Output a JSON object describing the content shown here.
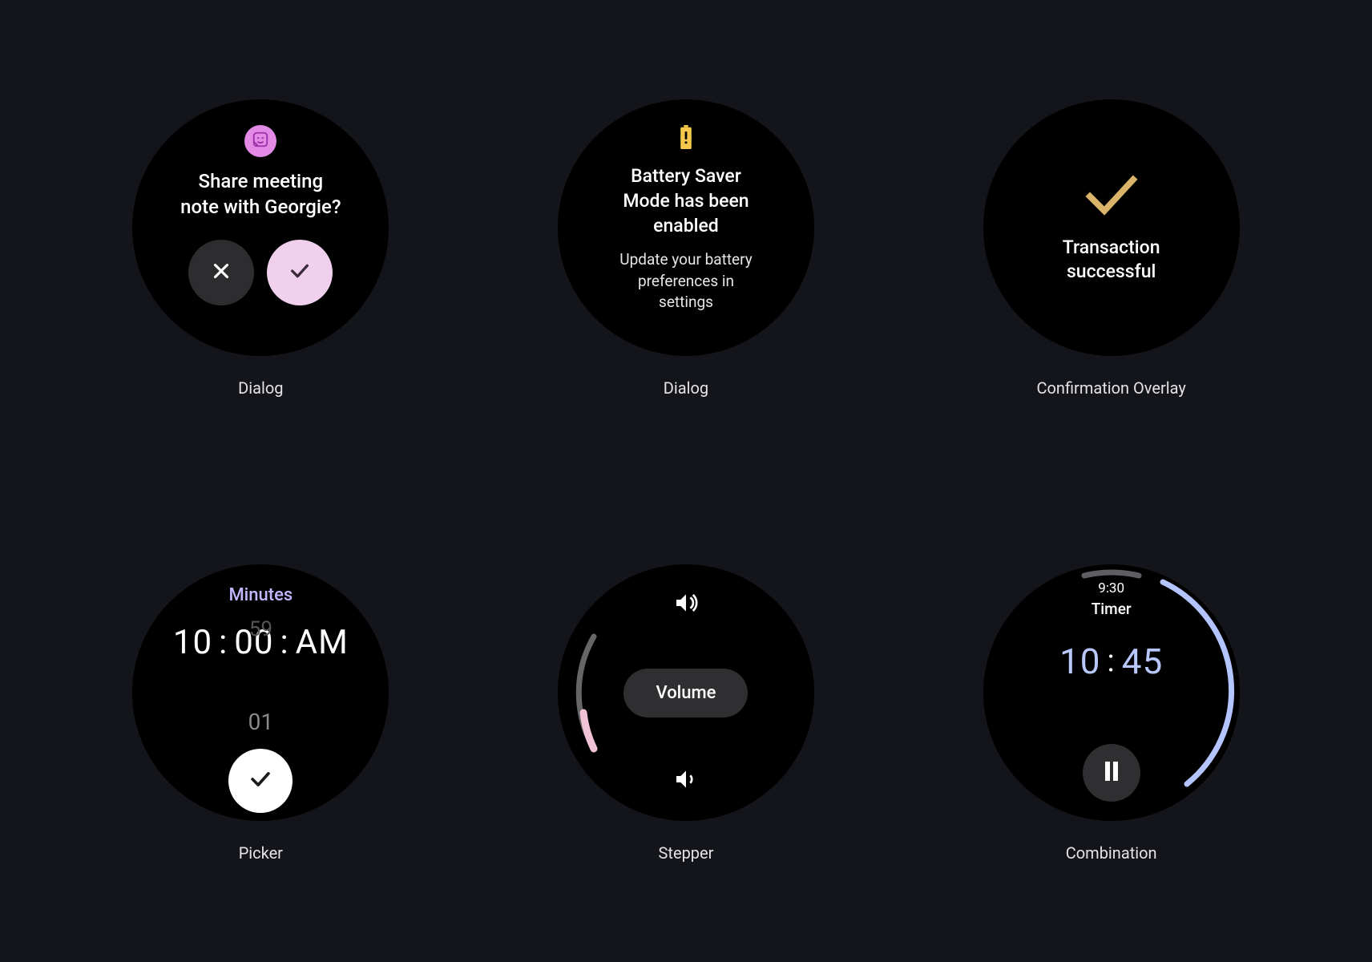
{
  "watches": [
    {
      "caption": "Dialog",
      "title": "Share meeting\nnote with Georgie?",
      "icon": "sticker-icon",
      "colors": {
        "accent": "#e28ae6",
        "confirm_bg": "#f1d0ed"
      }
    },
    {
      "caption": "Dialog",
      "title": "Battery Saver\nMode has been\nenabled",
      "subtitle": "Update your battery\npreferences in\nsettings",
      "icon": "battery-alert-icon",
      "colors": {
        "icon": "#f5c84c"
      }
    },
    {
      "caption": "Confirmation Overlay",
      "title": "Transaction\nsuccessful",
      "icon": "check-icon",
      "colors": {
        "icon": "#d9b469"
      }
    },
    {
      "caption": "Picker",
      "label": "Minutes",
      "hour": "10",
      "minute": "00",
      "ampm": "AM",
      "ghost_above": "59",
      "ghost_below": "01"
    },
    {
      "caption": "Stepper",
      "chip_label": "Volume",
      "colors": {
        "track": "#666",
        "fill": "#f1c3d6"
      }
    },
    {
      "caption": "Combination",
      "clock": "9:30",
      "title": "Timer",
      "timer_left": "10",
      "timer_right": "45",
      "colors": {
        "digits": "#b9c7ff",
        "arc": "#b3c4ff"
      }
    }
  ]
}
